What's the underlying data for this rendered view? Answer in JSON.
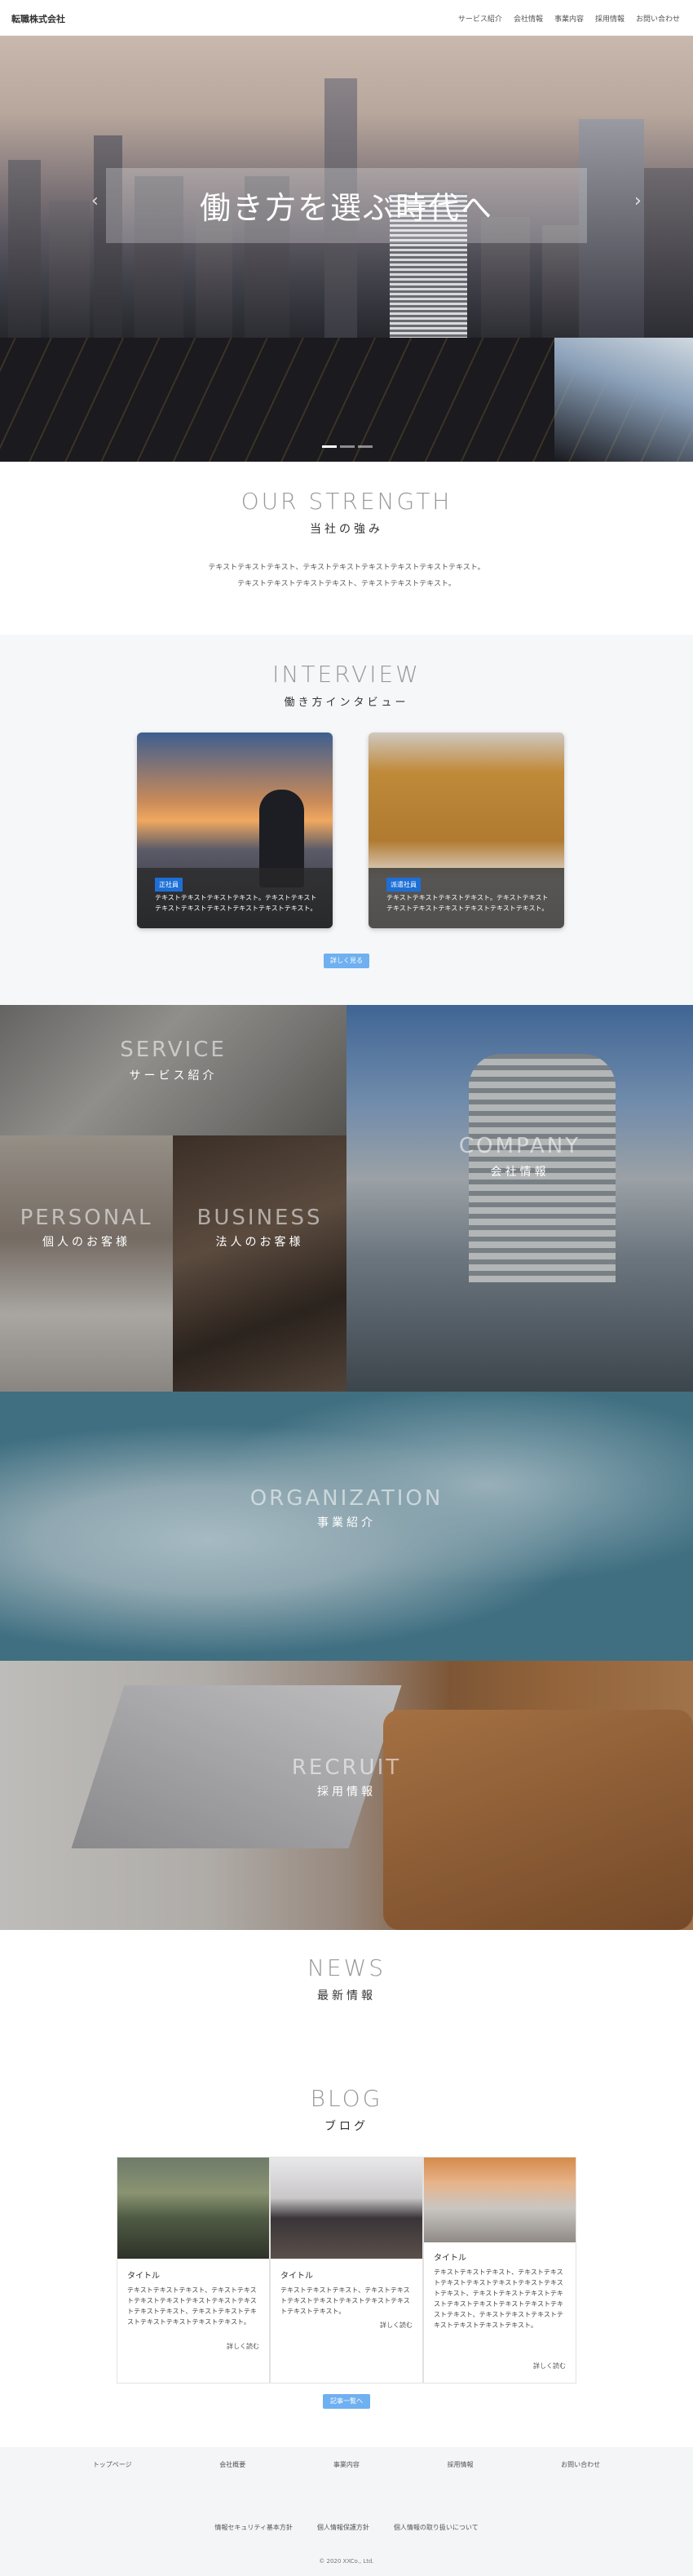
{
  "header": {
    "logo": "転職株式会社",
    "nav": [
      "サービス紹介",
      "会社情報",
      "事業内容",
      "採用情報",
      "お問い合わせ"
    ]
  },
  "hero": {
    "title": "働き方を選ぶ時代へ",
    "prev": "‹",
    "next": "›"
  },
  "strength": {
    "en": "OUR STRENGTH",
    "jp": "当社の強み",
    "lines": [
      "テキストテキストテキスト、テキストテキストテキストテキストテキストテキスト。",
      "テキストテキストテキストテキスト、テキストテキストテキスト。"
    ]
  },
  "interview": {
    "en": "INTERVIEW",
    "jp": "働き方インタビュー",
    "cards": [
      {
        "tag": "正社員",
        "text": "テキストテキストテキストテキスト。テキストテキストテキストテキストテキストテキストテキストテキスト。"
      },
      {
        "tag": "派遣社員",
        "text": "テキストテキストテキストテキスト。テキストテキストテキストテキストテキストテキストテキストテキスト。"
      }
    ],
    "button": "詳しく見る"
  },
  "tiles": {
    "service": {
      "en": "SERVICE",
      "jp": "サービス紹介"
    },
    "company": {
      "en": "COMPANY",
      "jp": "会社情報"
    },
    "personal": {
      "en": "PERSONAL",
      "jp": "個人のお客様"
    },
    "business": {
      "en": "BUSINESS",
      "jp": "法人のお客様"
    },
    "organization": {
      "en": "ORGANIZATION",
      "jp": "事業紹介"
    },
    "recruit": {
      "en": "RECRUIT",
      "jp": "採用情報"
    }
  },
  "news": {
    "en": "NEWS",
    "jp": "最新情報"
  },
  "blog": {
    "en": "BLOG",
    "jp": "ブログ",
    "posts": [
      {
        "title": "タイトル",
        "text": "テキストテキストテキスト、テキストテキストテキストテキストテキストテキストテキストテキストテキスト、テキストテキストテキストテキストテキストテキストテキスト。",
        "more": "詳しく読む"
      },
      {
        "title": "タイトル",
        "text": "テキストテキストテキスト、テキストテキストテキストテキストテキストテキストテキストテキストテキスト。",
        "more": "詳しく読む"
      },
      {
        "title": "タイトル",
        "text": "テキストテキストテキスト、テキストテキストテキストテキストテキストテキストテキストテキスト、テキストテキストテキストテキストテキストテキストテキストテキストテキストテキスト、テキストテキストテキストテキストテキストテキストテキスト。",
        "more": "詳しく読む"
      }
    ],
    "button": "記事一覧へ"
  },
  "footer": {
    "nav": [
      "トップページ",
      "会社概要",
      "事業内容",
      "採用情報",
      "お問い合わせ"
    ],
    "nav2": [
      "情報セキュリティ基本方針",
      "個人情報保護方針",
      "個人情報の取り扱いについて"
    ],
    "copyright": "© 2020 XXCo., Ltd."
  }
}
